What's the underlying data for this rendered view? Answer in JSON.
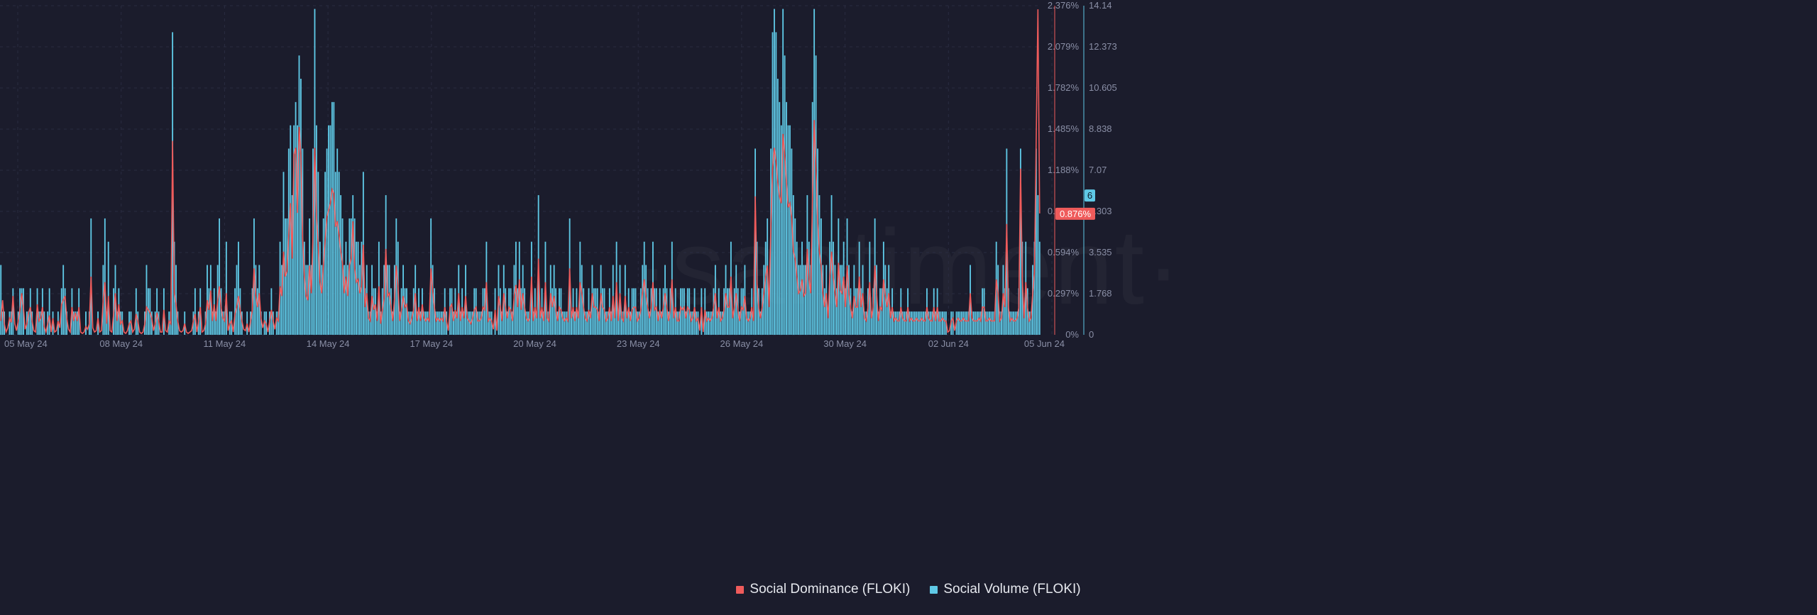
{
  "watermark": "·santiment·",
  "colors": {
    "background": "#1b1c2c",
    "grid": "#2a2c40",
    "axis_text": "#8a8fa6",
    "dominance": "#ef5b5b",
    "volume": "#5fc9e6"
  },
  "legend": [
    {
      "label": "Social Dominance (FLOKI)",
      "color": "#ef5b5b"
    },
    {
      "label": "Social Volume (FLOKI)",
      "color": "#5fc9e6"
    }
  ],
  "badges": {
    "dominance_current": "0.876%",
    "volume_current": "6"
  },
  "chart_data": {
    "type": "bar+line",
    "title": "",
    "x_ticks": [
      "05 May 24",
      "08 May 24",
      "11 May 24",
      "14 May 24",
      "17 May 24",
      "20 May 24",
      "23 May 24",
      "26 May 24",
      "30 May 24",
      "02 Jun 24",
      "05 Jun 24"
    ],
    "x_range": [
      "05 May 24",
      "05 Jun 24"
    ],
    "y_left": {
      "label": "Social Dominance (FLOKI)",
      "unit": "%",
      "ticks": [
        "0%",
        "0.297%",
        "0.594%",
        "0.891%",
        "1.188%",
        "1.485%",
        "1.782%",
        "2.079%",
        "2.376%"
      ],
      "range": [
        0,
        2.376
      ]
    },
    "y_right": {
      "label": "Social Volume (FLOKI)",
      "ticks": [
        "0",
        "1.768",
        "3.535",
        "5.303",
        "7.07",
        "8.838",
        "10.605",
        "12.373",
        "14.14"
      ],
      "range": [
        0,
        14.14
      ]
    },
    "series": [
      {
        "name": "Social Volume (FLOKI)",
        "type": "bar",
        "axis": "right",
        "values": [
          3,
          1,
          1,
          0,
          0,
          1,
          1,
          2,
          0,
          0,
          1,
          2,
          2,
          2,
          0,
          1,
          1,
          2,
          1,
          0,
          0,
          2,
          1,
          1,
          2,
          1,
          0,
          1,
          2,
          0,
          1,
          0,
          0,
          1,
          0,
          2,
          3,
          2,
          1,
          0,
          0,
          2,
          1,
          1,
          1,
          2,
          0,
          0,
          0,
          1,
          0,
          1,
          5,
          0,
          0,
          0,
          1,
          0,
          0,
          3,
          5,
          1,
          4,
          0,
          0,
          2,
          3,
          1,
          2,
          1,
          1,
          0,
          0,
          0,
          1,
          1,
          0,
          0,
          2,
          1,
          0,
          0,
          0,
          1,
          3,
          2,
          2,
          1,
          0,
          1,
          2,
          1,
          0,
          0,
          2,
          0,
          0,
          1,
          1,
          13,
          4,
          3,
          1,
          0,
          0,
          0,
          1,
          0,
          0,
          0,
          0,
          1,
          2,
          0,
          1,
          2,
          0,
          0,
          1,
          3,
          2,
          3,
          1,
          2,
          1,
          3,
          5,
          2,
          1,
          1,
          4,
          0,
          1,
          1,
          0,
          2,
          3,
          4,
          2,
          1,
          0,
          0,
          1,
          0,
          1,
          2,
          5,
          3,
          2,
          3,
          1,
          0,
          1,
          1,
          0,
          1,
          2,
          1,
          0,
          1,
          1,
          4,
          3,
          7,
          5,
          5,
          8,
          9,
          6,
          9,
          10,
          9,
          12,
          11,
          8,
          4,
          3,
          3,
          5,
          3,
          8,
          14,
          9,
          7,
          4,
          3,
          5,
          7,
          8,
          9,
          9,
          10,
          10,
          7,
          8,
          7,
          6,
          5,
          3,
          4,
          3,
          5,
          5,
          6,
          5,
          4,
          4,
          3,
          4,
          7,
          2,
          3,
          1,
          1,
          3,
          2,
          2,
          1,
          4,
          1,
          2,
          3,
          6,
          3,
          3,
          2,
          1,
          3,
          5,
          4,
          1,
          2,
          3,
          2,
          2,
          1,
          1,
          1,
          2,
          3,
          1,
          2,
          1,
          2,
          1,
          1,
          1,
          1,
          5,
          3,
          2,
          1,
          1,
          1,
          1,
          1,
          2,
          1,
          0,
          2,
          2,
          1,
          2,
          1,
          3,
          1,
          2,
          1,
          3,
          1,
          1,
          1,
          1,
          2,
          2,
          1,
          1,
          1,
          2,
          2,
          4,
          1,
          1,
          1,
          0,
          2,
          0,
          3,
          2,
          1,
          3,
          2,
          1,
          2,
          2,
          1,
          3,
          4,
          2,
          4,
          2,
          3,
          2,
          1,
          1,
          1,
          4,
          1,
          2,
          1,
          6,
          1,
          2,
          1,
          4,
          1,
          1,
          3,
          2,
          3,
          2,
          1,
          2,
          2,
          1,
          1,
          1,
          1,
          5,
          1,
          2,
          1,
          2,
          1,
          4,
          3,
          2,
          1,
          1,
          2,
          1,
          3,
          2,
          2,
          2,
          1,
          3,
          2,
          2,
          1,
          1,
          2,
          1,
          3,
          1,
          4,
          1,
          3,
          1,
          1,
          3,
          1,
          2,
          1,
          2,
          2,
          2,
          1,
          1,
          2,
          3,
          4,
          3,
          2,
          1,
          2,
          4,
          2,
          2,
          1,
          2,
          1,
          2,
          3,
          2,
          1,
          2,
          4,
          1,
          2,
          1,
          1,
          2,
          2,
          2,
          1,
          2,
          2,
          1,
          1,
          2,
          1,
          1,
          0,
          2,
          0,
          2,
          1,
          1,
          1,
          1,
          2,
          3,
          1,
          2,
          1,
          1,
          2,
          3,
          2,
          2,
          4,
          1,
          2,
          3,
          2,
          1,
          2,
          2,
          3,
          1,
          1,
          1,
          2,
          1,
          8,
          4,
          2,
          1,
          2,
          3,
          4,
          5,
          2,
          8,
          13,
          14,
          13,
          11,
          10,
          9,
          14,
          12,
          10,
          9,
          9,
          8,
          6,
          5,
          4,
          3,
          3,
          4,
          3,
          3,
          6,
          4,
          3,
          10,
          14,
          12,
          8,
          6,
          5,
          3,
          2,
          3,
          1,
          4,
          6,
          4,
          3,
          2,
          5,
          3,
          3,
          4,
          2,
          5,
          3,
          2,
          1,
          3,
          2,
          2,
          4,
          2,
          3,
          1,
          1,
          2,
          4,
          1,
          2,
          5,
          3,
          1,
          2,
          2,
          4,
          3,
          2,
          3,
          1,
          2,
          1,
          1,
          1,
          1,
          2,
          1,
          1,
          1,
          2,
          1,
          1,
          1,
          1,
          1,
          1,
          1,
          1,
          1,
          1,
          2,
          1,
          1,
          1,
          2,
          1,
          2,
          1,
          1,
          1,
          1,
          1,
          0,
          0,
          1,
          1,
          0,
          1,
          1,
          1,
          1,
          1,
          1,
          1,
          1,
          3,
          1,
          1,
          1,
          1,
          1,
          1,
          2,
          2,
          1,
          1,
          1,
          1,
          1,
          1,
          4,
          3,
          1,
          1,
          3,
          2,
          8,
          2,
          1,
          1,
          1,
          1,
          1,
          2,
          8,
          4,
          1,
          4,
          2,
          1,
          1,
          3,
          4,
          8,
          6,
          4
        ],
        "current": 6
      },
      {
        "name": "Social Dominance (FLOKI)",
        "type": "line",
        "axis": "left",
        "values": [
          0.1,
          0.25,
          0.08,
          0.02,
          0.05,
          0.12,
          0.09,
          0.28,
          0.08,
          0.03,
          0.1,
          0.18,
          0.3,
          0.2,
          0.04,
          0.08,
          0.16,
          0.2,
          0.1,
          0.03,
          0.02,
          0.22,
          0.1,
          0.12,
          0.2,
          0.06,
          0.02,
          0.08,
          0.14,
          0.02,
          0.12,
          0.02,
          0.03,
          0.1,
          0.05,
          0.22,
          0.25,
          0.28,
          0.12,
          0.04,
          0.02,
          0.2,
          0.1,
          0.16,
          0.1,
          0.2,
          0.02,
          0.01,
          0.02,
          0.06,
          0.04,
          0.08,
          0.42,
          0.05,
          0.02,
          0.03,
          0.12,
          0.02,
          0.03,
          0.25,
          0.38,
          0.08,
          0.28,
          0.03,
          0.02,
          0.15,
          0.3,
          0.1,
          0.22,
          0.08,
          0.1,
          0.02,
          0.01,
          0.03,
          0.08,
          0.1,
          0.02,
          0.04,
          0.15,
          0.1,
          0.02,
          0.01,
          0.02,
          0.08,
          0.2,
          0.18,
          0.16,
          0.12,
          0.03,
          0.08,
          0.16,
          0.1,
          0.02,
          0.02,
          0.18,
          0.03,
          0.02,
          0.1,
          0.08,
          1.4,
          0.3,
          0.22,
          0.1,
          0.03,
          0.02,
          0.03,
          0.08,
          0.02,
          0.01,
          0.02,
          0.03,
          0.1,
          0.15,
          0.02,
          0.1,
          0.2,
          0.02,
          0.03,
          0.08,
          0.25,
          0.18,
          0.32,
          0.1,
          0.22,
          0.1,
          0.25,
          0.35,
          0.2,
          0.12,
          0.1,
          0.3,
          0.03,
          0.08,
          0.1,
          0.02,
          0.15,
          0.2,
          0.28,
          0.18,
          0.1,
          0.04,
          0.03,
          0.08,
          0.02,
          0.1,
          0.18,
          0.48,
          0.28,
          0.2,
          0.3,
          0.12,
          0.05,
          0.1,
          0.08,
          0.02,
          0.1,
          0.18,
          0.1,
          0.04,
          0.12,
          0.1,
          0.35,
          0.28,
          0.6,
          0.42,
          0.46,
          0.72,
          0.95,
          0.55,
          1.3,
          1.35,
          0.88,
          1.5,
          1.3,
          0.7,
          0.42,
          0.28,
          0.25,
          0.5,
          0.3,
          0.72,
          1.35,
          0.85,
          0.65,
          0.38,
          0.3,
          0.5,
          0.68,
          0.85,
          0.9,
          0.95,
          1.05,
          1.02,
          0.78,
          0.82,
          0.72,
          0.6,
          0.52,
          0.3,
          0.42,
          0.28,
          0.5,
          0.55,
          0.82,
          0.48,
          0.38,
          0.4,
          0.3,
          0.35,
          0.65,
          0.2,
          0.3,
          0.12,
          0.1,
          0.28,
          0.18,
          0.22,
          0.1,
          0.35,
          0.08,
          0.18,
          0.26,
          0.62,
          0.28,
          0.3,
          0.2,
          0.1,
          0.26,
          0.5,
          0.35,
          0.1,
          0.18,
          0.28,
          0.2,
          0.22,
          0.1,
          0.08,
          0.12,
          0.18,
          0.3,
          0.1,
          0.2,
          0.1,
          0.22,
          0.12,
          0.1,
          0.12,
          0.1,
          0.48,
          0.32,
          0.2,
          0.1,
          0.12,
          0.1,
          0.12,
          0.1,
          0.2,
          0.1,
          0.03,
          0.2,
          0.22,
          0.1,
          0.18,
          0.12,
          0.3,
          0.1,
          0.2,
          0.12,
          0.28,
          0.12,
          0.1,
          0.08,
          0.12,
          0.18,
          0.2,
          0.1,
          0.1,
          0.12,
          0.2,
          0.18,
          0.38,
          0.1,
          0.12,
          0.1,
          0.04,
          0.18,
          0.03,
          0.28,
          0.2,
          0.1,
          0.3,
          0.2,
          0.12,
          0.2,
          0.18,
          0.1,
          0.28,
          0.36,
          0.2,
          0.4,
          0.18,
          0.3,
          0.2,
          0.12,
          0.1,
          0.12,
          0.42,
          0.1,
          0.2,
          0.12,
          0.55,
          0.12,
          0.2,
          0.1,
          0.38,
          0.12,
          0.1,
          0.3,
          0.2,
          0.28,
          0.18,
          0.1,
          0.2,
          0.18,
          0.12,
          0.1,
          0.12,
          0.1,
          0.48,
          0.12,
          0.2,
          0.1,
          0.2,
          0.12,
          0.38,
          0.3,
          0.2,
          0.12,
          0.1,
          0.18,
          0.12,
          0.3,
          0.2,
          0.2,
          0.18,
          0.1,
          0.3,
          0.2,
          0.18,
          0.1,
          0.12,
          0.2,
          0.1,
          0.28,
          0.12,
          0.38,
          0.1,
          0.3,
          0.12,
          0.1,
          0.28,
          0.12,
          0.2,
          0.1,
          0.18,
          0.2,
          0.2,
          0.1,
          0.12,
          0.18,
          0.3,
          0.4,
          0.28,
          0.2,
          0.12,
          0.2,
          0.38,
          0.18,
          0.2,
          0.1,
          0.18,
          0.12,
          0.2,
          0.3,
          0.2,
          0.1,
          0.18,
          0.4,
          0.12,
          0.2,
          0.1,
          0.1,
          0.2,
          0.18,
          0.2,
          0.12,
          0.2,
          0.18,
          0.1,
          0.12,
          0.2,
          0.1,
          0.12,
          0.03,
          0.2,
          0.02,
          0.18,
          0.1,
          0.12,
          0.1,
          0.12,
          0.2,
          0.3,
          0.12,
          0.2,
          0.1,
          0.12,
          0.18,
          0.3,
          0.2,
          0.2,
          0.42,
          0.12,
          0.2,
          0.3,
          0.18,
          0.1,
          0.2,
          0.18,
          0.28,
          0.12,
          0.1,
          0.12,
          0.2,
          0.1,
          1.0,
          0.38,
          0.2,
          0.12,
          0.2,
          0.3,
          0.42,
          0.5,
          0.2,
          0.78,
          1.2,
          1.35,
          1.25,
          1.1,
          1.0,
          0.95,
          1.45,
          1.3,
          1.1,
          0.92,
          0.95,
          0.85,
          0.6,
          0.55,
          0.42,
          0.3,
          0.32,
          0.4,
          0.28,
          0.3,
          0.62,
          0.4,
          0.3,
          0.98,
          1.55,
          1.2,
          0.82,
          0.6,
          0.5,
          0.3,
          0.2,
          0.3,
          0.12,
          0.42,
          0.6,
          0.42,
          0.3,
          0.2,
          0.52,
          0.32,
          0.3,
          0.42,
          0.2,
          0.5,
          0.3,
          0.2,
          0.12,
          0.28,
          0.2,
          0.2,
          0.42,
          0.2,
          0.3,
          0.12,
          0.1,
          0.2,
          0.38,
          0.12,
          0.2,
          0.5,
          0.3,
          0.1,
          0.2,
          0.18,
          0.4,
          0.28,
          0.2,
          0.3,
          0.12,
          0.2,
          0.1,
          0.12,
          0.1,
          0.1,
          0.2,
          0.12,
          0.1,
          0.1,
          0.2,
          0.1,
          0.12,
          0.1,
          0.1,
          0.12,
          0.1,
          0.1,
          0.12,
          0.1,
          0.1,
          0.2,
          0.12,
          0.1,
          0.1,
          0.2,
          0.1,
          0.2,
          0.1,
          0.1,
          0.12,
          0.1,
          0.1,
          0.02,
          0.03,
          0.1,
          0.12,
          0.03,
          0.1,
          0.12,
          0.1,
          0.1,
          0.12,
          0.1,
          0.1,
          0.1,
          0.3,
          0.12,
          0.1,
          0.1,
          0.1,
          0.12,
          0.1,
          0.2,
          0.2,
          0.1,
          0.1,
          0.12,
          0.1,
          0.1,
          0.1,
          0.4,
          0.3,
          0.1,
          0.12,
          0.3,
          0.2,
          0.8,
          0.2,
          0.1,
          0.12,
          0.1,
          0.1,
          0.12,
          0.2,
          1.2,
          0.4,
          0.12,
          0.38,
          0.2,
          0.1,
          0.12,
          0.3,
          0.45,
          1.4,
          2.35,
          0.876
        ],
        "current": 0.876
      }
    ]
  }
}
